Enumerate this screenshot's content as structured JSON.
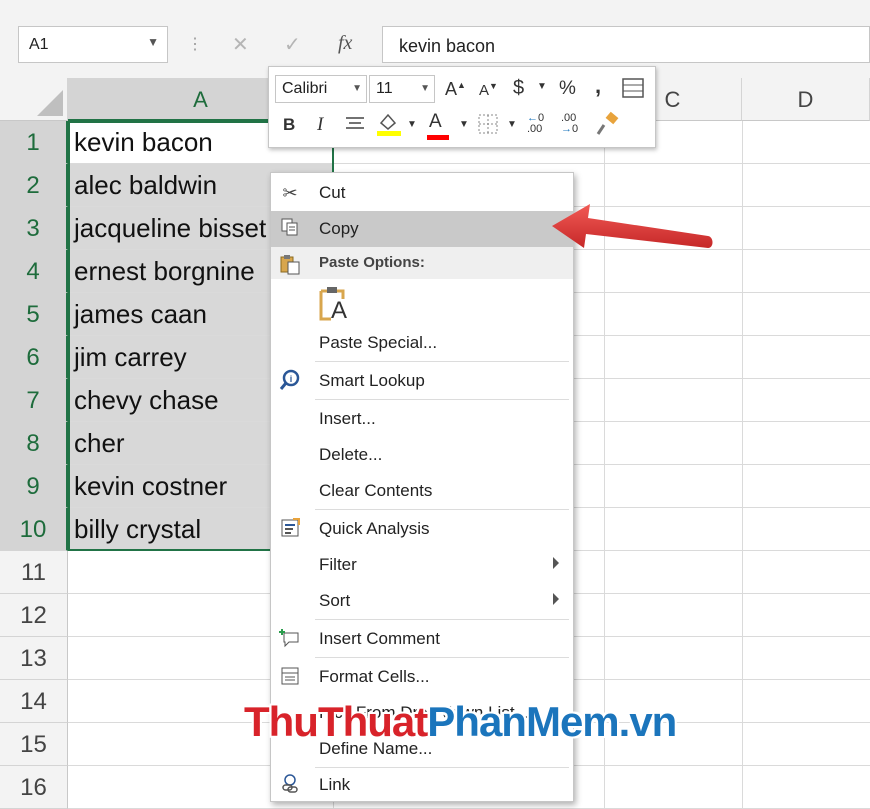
{
  "formula_bar": {
    "name_box": "A1",
    "cancel_glyph": "✕",
    "enter_glyph": "✓",
    "fx_glyph": "fx",
    "formula_value": "kevin bacon"
  },
  "columns": [
    "A",
    "C",
    "D"
  ],
  "rows": [
    {
      "num": "1",
      "a": "kevin bacon"
    },
    {
      "num": "2",
      "a": "alec baldwin"
    },
    {
      "num": "3",
      "a": "jacqueline bisset"
    },
    {
      "num": "4",
      "a": "ernest borgnine"
    },
    {
      "num": "5",
      "a": "james caan"
    },
    {
      "num": "6",
      "a": "jim carrey"
    },
    {
      "num": "7",
      "a": "chevy chase"
    },
    {
      "num": "8",
      "a": "cher"
    },
    {
      "num": "9",
      "a": "kevin costner"
    },
    {
      "num": "10",
      "a": "billy crystal"
    },
    {
      "num": "11",
      "a": ""
    },
    {
      "num": "12",
      "a": ""
    },
    {
      "num": "13",
      "a": ""
    },
    {
      "num": "14",
      "a": ""
    },
    {
      "num": "15",
      "a": ""
    },
    {
      "num": "16",
      "a": ""
    }
  ],
  "mini_toolbar": {
    "font": "Calibri",
    "size": "11",
    "increase_font": "A",
    "decrease_font": "A",
    "currency": "$",
    "percent": "%",
    "comma": ",",
    "bold": "B",
    "italic": "I",
    "font_color": "A",
    "increase_decimal": ".00",
    "decrease_decimal": ".00"
  },
  "context_menu": {
    "cut": "Cut",
    "copy": "Copy",
    "paste_options": "Paste Options:",
    "paste_icon_letter": "A",
    "paste_special": "Paste Special...",
    "smart_lookup": "Smart Lookup",
    "insert": "Insert...",
    "delete": "Delete...",
    "clear_contents": "Clear Contents",
    "quick_analysis": "Quick Analysis",
    "filter": "Filter",
    "sort": "Sort",
    "insert_comment": "Insert Comment",
    "format_cells": "Format Cells...",
    "pick_from_dropdown": "Pick From Drop-down List...",
    "define_name": "Define Name...",
    "link": "Link"
  },
  "watermark": {
    "part1": "ThuThuat",
    "part2": "PhanMem",
    "part3": ".vn"
  },
  "colors": {
    "selection_green": "#217346",
    "arrow_red": "#e53935"
  }
}
